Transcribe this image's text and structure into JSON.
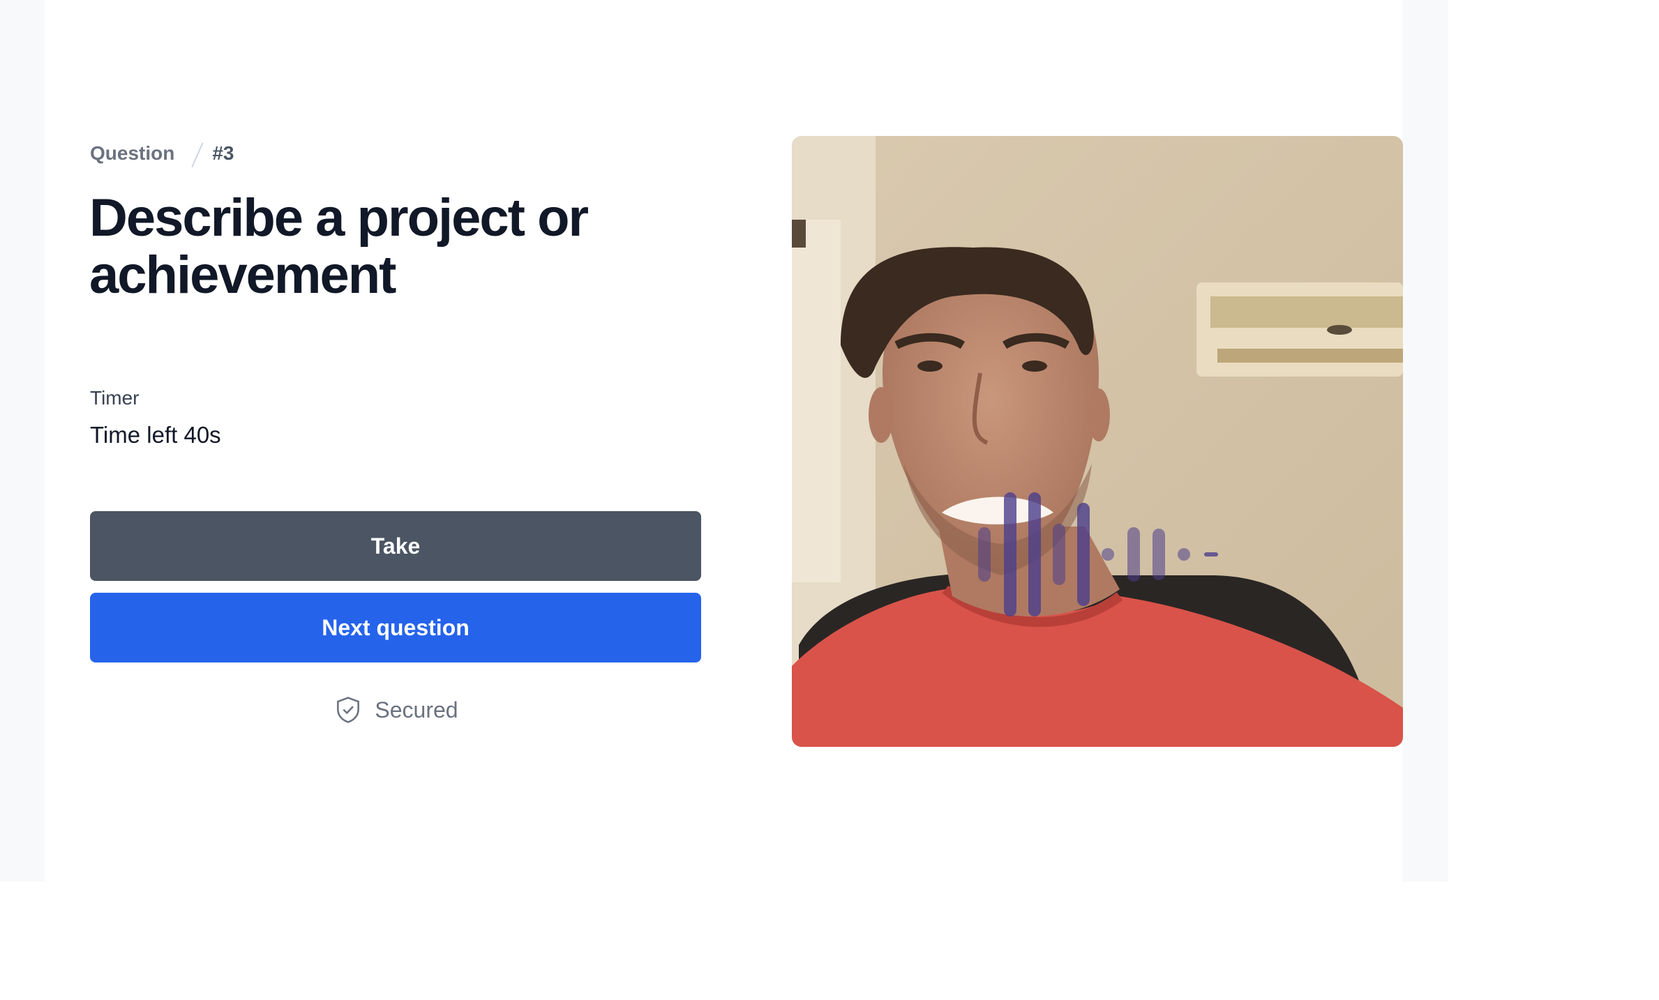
{
  "breadcrumb": {
    "section": "Question",
    "number": "#3"
  },
  "question": {
    "title": "Describe a project or achievement"
  },
  "timer": {
    "label": "Timer",
    "value": "Time left 40s"
  },
  "actions": {
    "take_label": "Take",
    "next_label": "Next question"
  },
  "security": {
    "label": "Secured",
    "icon": "shield-check-icon"
  },
  "video": {
    "feed": "webcam-feed",
    "audio_indicator": "audio-waveform-icon"
  },
  "colors": {
    "take_button": "#4b5563",
    "next_button": "#2563eb",
    "title": "#111827",
    "muted": "#6b7280",
    "waveform": "#4c3f8c"
  }
}
